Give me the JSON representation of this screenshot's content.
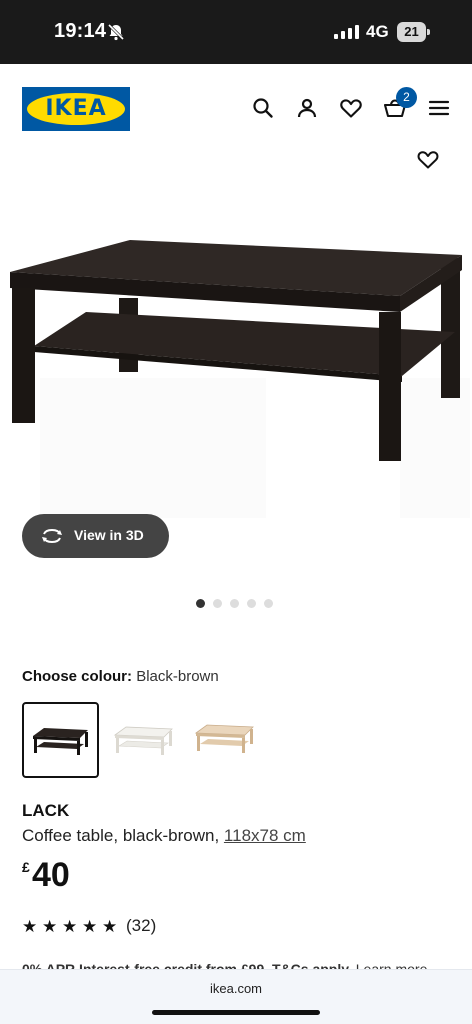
{
  "status_bar": {
    "time": "19:14",
    "network": "4G",
    "battery": "21"
  },
  "header": {
    "logo_text": "IKEA",
    "cart_count": "2"
  },
  "product_media": {
    "view_3d_label": "View in 3D",
    "dot_count": 5,
    "active_dot": 1
  },
  "colour": {
    "label": "Choose colour:",
    "selected": "Black-brown",
    "options": [
      {
        "name": "black-brown",
        "color": "#2a2320"
      },
      {
        "name": "white",
        "color": "#f1f0ec"
      },
      {
        "name": "white stained oak effect",
        "color": "#e3cdb2"
      }
    ]
  },
  "product": {
    "name": "LACK",
    "description": "Coffee table, black-brown, ",
    "dimensions": "118x78 cm",
    "currency": "£",
    "price": "40",
    "rating_stars": 5,
    "rating_count": "(32)",
    "credit_text": "0% APR Interest-free credit from £99. T&Cs apply.",
    "credit_link": " Learn more"
  },
  "browser": {
    "url": "ikea.com"
  },
  "colors": {
    "ikea_blue": "#0058a3",
    "ikea_yellow": "#ffdb00",
    "table": "#2b2421"
  }
}
